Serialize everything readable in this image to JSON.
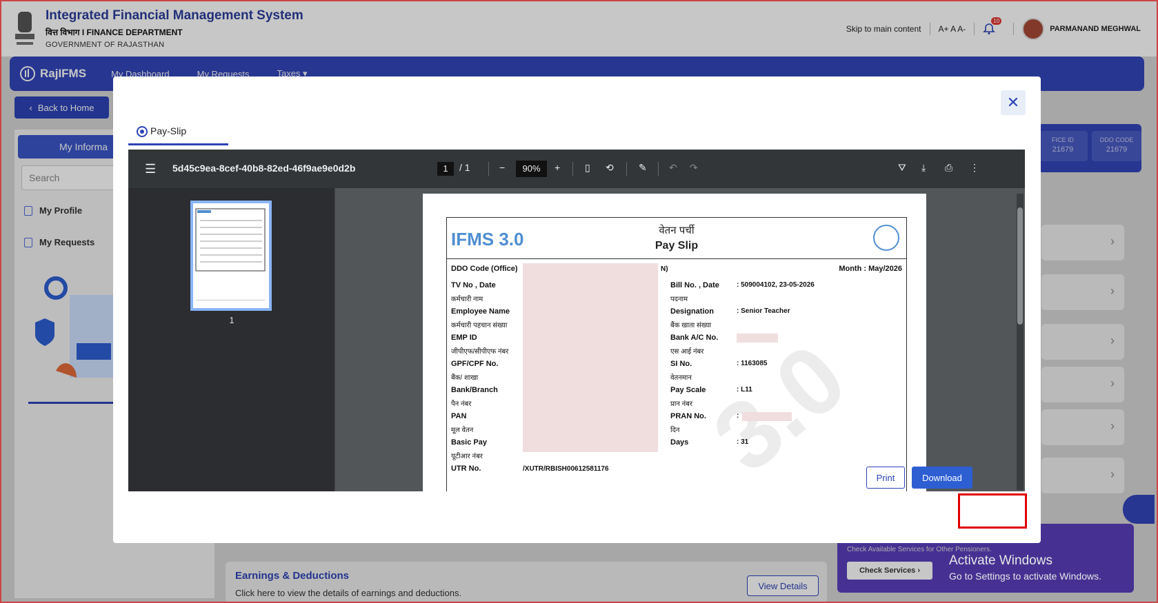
{
  "header": {
    "title": "Integrated Financial Management System",
    "dept_hindi": "वित्त विभाग",
    "dept_sep": "I",
    "dept": "FINANCE DEPARTMENT",
    "gov": "GOVERNMENT OF RAJASTHAN",
    "skip": "Skip to main content",
    "font_controls": "A+ A A-",
    "notif_count": "10",
    "user": "PARMANAND MEGHWAL"
  },
  "nav": {
    "logo": "RajIFMS",
    "items": [
      "My Dashboard",
      "My Requests",
      "Taxes ▾"
    ]
  },
  "back_label": "Back to Home",
  "sidebar": {
    "tab": "My Informa",
    "search_placeholder": "Search",
    "items": [
      "My Profile",
      "My Requests"
    ]
  },
  "right": {
    "office_id_label": "FICE ID",
    "office_id": "21679",
    "ddo_label": "DDO CODE",
    "ddo": "21679"
  },
  "earnings": {
    "title": "Earnings & Deductions",
    "subtitle": "Click here to view the details of earnings and deductions.",
    "button": "View Details"
  },
  "pension": {
    "text": "Check Available Services for Other Pensioners.",
    "button": "Check Services ›"
  },
  "windows": {
    "line1": "Activate Windows",
    "line2": "Go to Settings to activate Windows."
  },
  "modal": {
    "tab": "Pay-Slip",
    "viewer": {
      "filename": "5d45c9ea-8cef-40b8-82ed-46f9ae9e0d2b",
      "page": "1",
      "pages": "/ 1",
      "zoom": "90%",
      "thumb_num": "1"
    },
    "slip": {
      "logo": "IFMS 3.0",
      "title_hi": "वेतन पर्ची",
      "title_en": "Pay Slip",
      "ddo_code": "DDO Code (Office)",
      "ddo_suffix": "N)",
      "month": "Month : May/2026",
      "left": [
        {
          "hi": "",
          "en": "TV No , Date"
        },
        {
          "hi": "कर्मचारी नाम",
          "en": "Employee Name"
        },
        {
          "hi": "कर्मचारी पहचान संख्या",
          "en": "EMP ID"
        },
        {
          "hi": "जीपीएफ/सीपीएफ नंबर",
          "en": "GPF/CPF No."
        },
        {
          "hi": "बैंक/ शाखा",
          "en": "Bank/Branch"
        },
        {
          "hi": "पैन नंबर",
          "en": "PAN"
        },
        {
          "hi": "मूल वेतन",
          "en": "Basic Pay"
        },
        {
          "hi": "यूटीआर नंबर",
          "en": "UTR No."
        }
      ],
      "right": [
        {
          "hi": "",
          "en": "Bill No. , Date",
          "val": ": 509004102, 23-05-2026"
        },
        {
          "hi": "पदनाम",
          "en": "Designation",
          "val": ": Senior Teacher"
        },
        {
          "hi": "बैंक खाता संख्या",
          "en": "Bank A/C No.",
          "val": ""
        },
        {
          "hi": "एस आई नंबर",
          "en": "SI No.",
          "val": ": 1163085"
        },
        {
          "hi": "वेतनमान",
          "en": "Pay Scale",
          "val": ": L11"
        },
        {
          "hi": "प्रान नंबर",
          "en": "PRAN No.",
          "val": ":"
        },
        {
          "hi": "दिन",
          "en": "Days",
          "val": ": 31"
        }
      ],
      "utr_value": "/XUTR/RBISH00612581176",
      "watermark": "3.0"
    },
    "print": "Print",
    "download": "Download"
  }
}
